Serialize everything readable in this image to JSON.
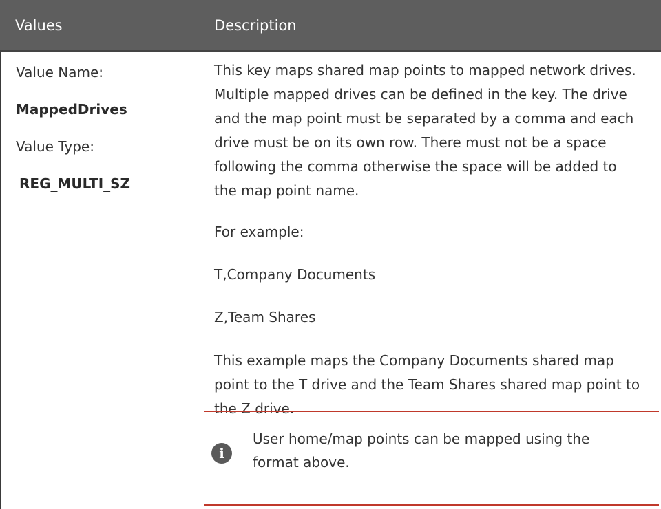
{
  "table": {
    "header": {
      "values": "Values",
      "description": "Description"
    },
    "values_column": {
      "name_label": "Value Name:",
      "name": "MappedDrives",
      "type_label": "Value Type:",
      "type": "REG_MULTI_SZ"
    },
    "description": {
      "intro": "This key maps shared map points to mapped network drives. Multiple mapped drives can be defined in the key. The drive and the map point must be separated by a comma and each drive must be on its own row. There must not be a space following the comma otherwise the space will be added to the map point name.",
      "example_label": "For example:",
      "example_1": "T,Company Documents",
      "example_2": "Z,Team Shares",
      "explanation": "This example maps the Company Documents shared map point to the T drive and the Team Shares shared map point to the Z drive."
    },
    "note": {
      "icon": "info-icon",
      "text": "User home/map points can be mapped using the format above."
    }
  },
  "colors": {
    "header_background": "#5e5e5e",
    "note_border": "#c0392b",
    "icon_background": "#5a5a5a"
  }
}
